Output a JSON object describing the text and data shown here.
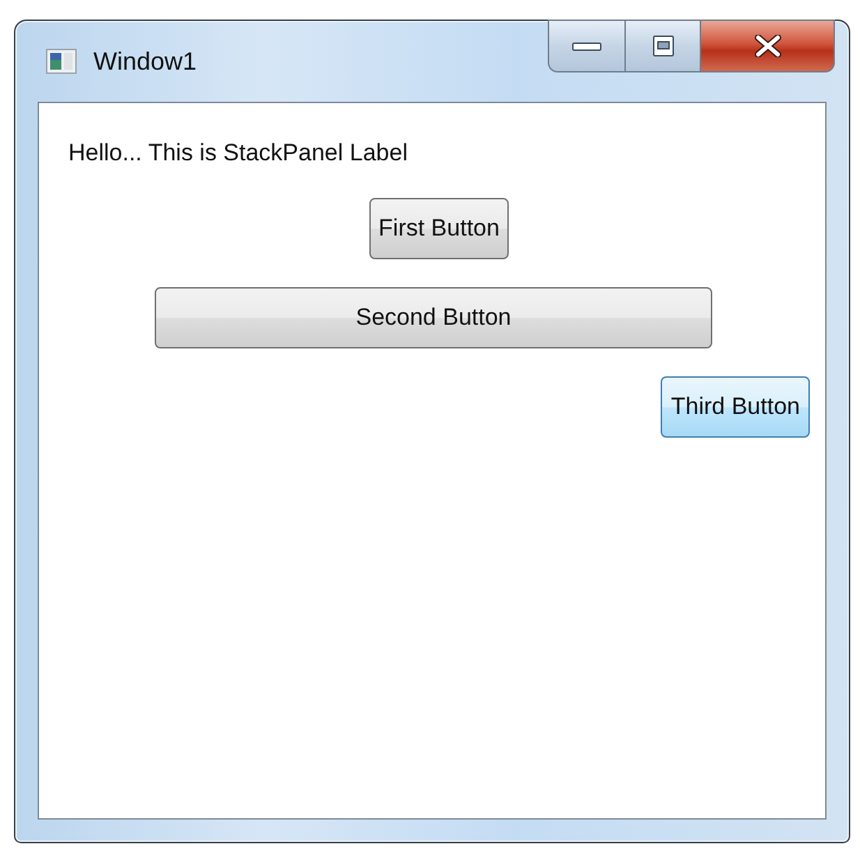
{
  "window": {
    "title": "Window1"
  },
  "label": "Hello... This is StackPanel Label",
  "buttons": [
    {
      "label": "First Button",
      "kind": "centered",
      "highlighted": false
    },
    {
      "label": "Second Button",
      "kind": "wide",
      "highlighted": false
    },
    {
      "label": "Third Button",
      "kind": "trailing",
      "highlighted": true
    }
  ]
}
